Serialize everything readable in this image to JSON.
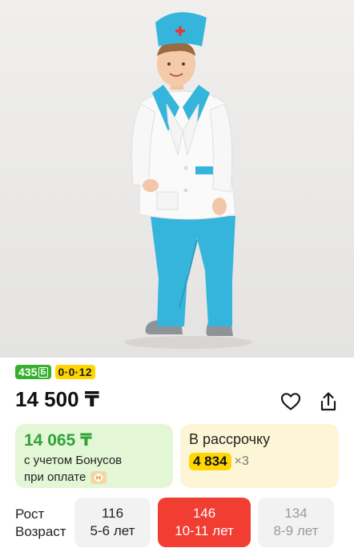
{
  "product": {
    "image_alt": "",
    "bonus_badge": {
      "value": "435",
      "currency": "Б"
    },
    "installment_badge": "0·0·12",
    "price": "14 500 ₸"
  },
  "icons": {
    "favorite": "heart-icon",
    "share": "share-icon",
    "payment": "payment-card-icon"
  },
  "bonus_card": {
    "price": "14 065 ₸",
    "line1": "с учетом Бонусов",
    "line2": "при оплате"
  },
  "installment_card": {
    "title": "В рассрочку",
    "amount": "4 834",
    "multiplier": "×3"
  },
  "sizes": {
    "label_height": "Рост",
    "label_age": "Возраст",
    "options": [
      {
        "height": "116",
        "age": "5-6 лет",
        "state": "available"
      },
      {
        "height": "146",
        "age": "10-11 лет",
        "state": "selected"
      },
      {
        "height": "134",
        "age": "8-9 лет",
        "state": "unavailable"
      }
    ]
  },
  "colors": {
    "bonus_green": "#35b02d",
    "installment_yellow": "#ffd600",
    "selected_red": "#f23d33",
    "green_card_bg": "#e3f6d6",
    "yellow_card_bg": "#fdf6d6"
  }
}
